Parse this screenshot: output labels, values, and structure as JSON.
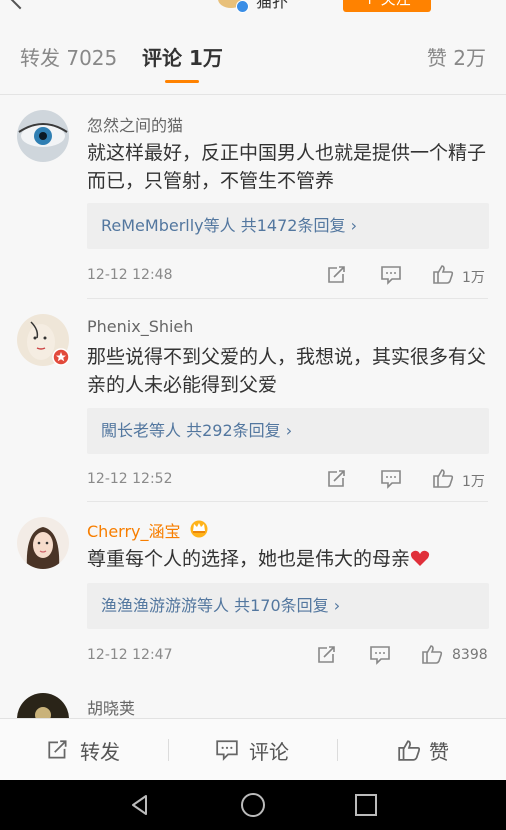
{
  "header": {
    "partial_name": "猫扑",
    "follow_label": "+ 关注"
  },
  "tabs": {
    "repost": "转发 7025",
    "comment": "评论 1万",
    "like": "赞 2万"
  },
  "comments": [
    {
      "username": "忽然之间的猫",
      "text": "就这样最好，反正中国男人也就是提供一个精子而已，只管射，不管生不管养",
      "replies_names": "ReMeMberlly等人",
      "replies_count": "共1472条回复",
      "time": "12-12 12:48",
      "likes": "1万"
    },
    {
      "username": "Phenix_Shieh",
      "text": "那些说得不到父爱的人，我想说，其实很多有父亲的人未必能得到父爱",
      "replies_names": "闖长老等人",
      "replies_count": "共292条回复",
      "time": "12-12 12:52",
      "likes": "1万"
    },
    {
      "username": "Cherry_涵宝",
      "text": "尊重每个人的选择，她也是伟大的母亲",
      "replies_names": "渔渔渔游游游等人",
      "replies_count": "共170条回复",
      "time": "12-12 12:47",
      "likes": "8398"
    },
    {
      "username": "胡晓荚"
    }
  ],
  "bottom_bar": {
    "repost": "转发",
    "comment": "评论",
    "like": "赞"
  },
  "icons": {
    "share": "share-icon",
    "comment": "comment-icon",
    "like": "thumb-up-icon",
    "back": "back-icon",
    "home": "home-icon",
    "recent": "recent-apps-icon"
  },
  "colors": {
    "accent": "#ff8200",
    "link": "#53779f",
    "vip_name": "#f77e00",
    "heart": "#e0303a"
  }
}
